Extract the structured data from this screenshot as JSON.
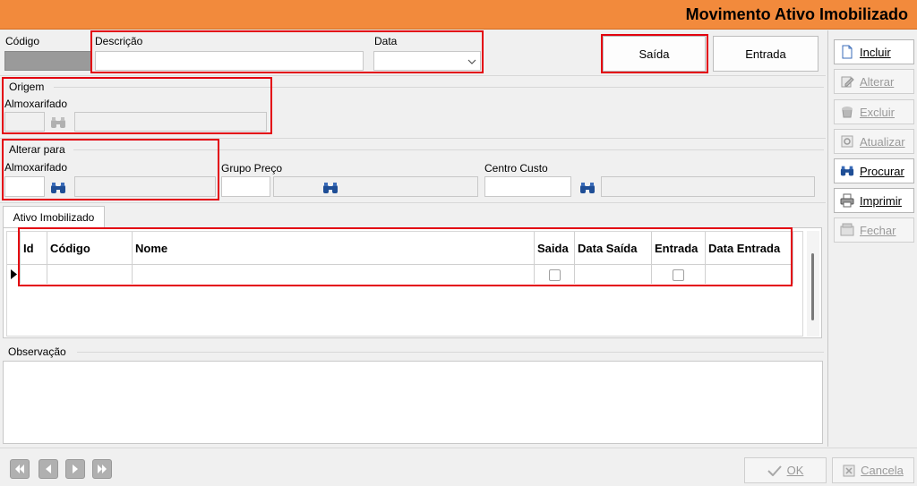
{
  "window": {
    "title": "Movimento Ativo Imobilizado"
  },
  "header": {
    "codigo_label": "Código",
    "descricao_label": "Descrição",
    "descricao_value": "",
    "data_label": "Data",
    "data_value": "",
    "saida_button": "Saída",
    "entrada_button": "Entrada"
  },
  "origem": {
    "group_label": "Origem",
    "almox_label": "Almoxarifado"
  },
  "alterar": {
    "group_label": "Alterar para",
    "almox_label": "Almoxarifado",
    "grupo_preco_label": "Grupo Preço",
    "centro_custo_label": "Centro Custo"
  },
  "tabs": [
    {
      "label": "Ativo Imobilizado"
    }
  ],
  "grid": {
    "columns": [
      "Id",
      "Código",
      "Nome",
      "Saida",
      "Data Saída",
      "Entrada",
      "Data Entrada"
    ]
  },
  "observacao": {
    "label": "Observação"
  },
  "sidebar": {
    "items": [
      {
        "label": "Incluir",
        "icon": "new-document-icon",
        "enabled": true
      },
      {
        "label": "Alterar",
        "icon": "edit-icon",
        "enabled": false
      },
      {
        "label": "Excluir",
        "icon": "delete-icon",
        "enabled": false
      },
      {
        "label": "Atualizar",
        "icon": "refresh-icon",
        "enabled": false
      },
      {
        "label": "Procurar",
        "icon": "binoculars-icon",
        "enabled": true
      },
      {
        "label": "Imprimir",
        "icon": "printer-icon",
        "enabled": true
      },
      {
        "label": "Fechar",
        "icon": "close-icon",
        "enabled": false
      }
    ]
  },
  "footer": {
    "ok_label": "OK",
    "cancel_label": "Cancela"
  },
  "colors": {
    "titlebar": "#f28a3c",
    "highlight": "#e3000f"
  }
}
